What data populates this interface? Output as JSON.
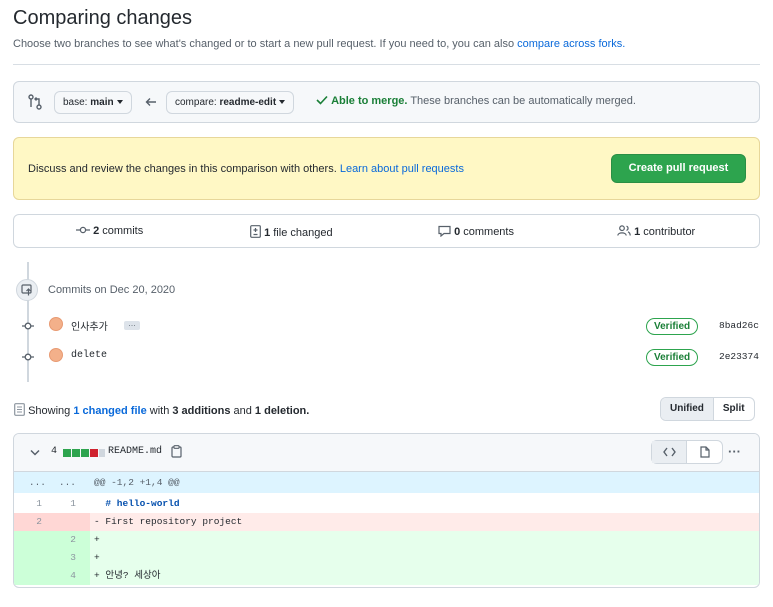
{
  "header": {
    "title": "Comparing changes",
    "subtitle": "Choose two branches to see what's changed or to start a new pull request. If you need to, you can also",
    "subtitle_link": "compare across forks."
  },
  "compare": {
    "base_prefix": "base: ",
    "base_branch": "main",
    "compare_prefix": "compare: ",
    "compare_branch": "readme-edit",
    "merge_status": "Able to merge.",
    "merge_detail": "These branches can be automatically merged."
  },
  "flash": {
    "text": "Discuss and review the changes in this comparison with others.",
    "link": "Learn about pull requests",
    "button": "Create pull request"
  },
  "stats": {
    "commits_count": "2",
    "commits_label": "commits",
    "files_count": "1",
    "files_label": "file changed",
    "comments_count": "0",
    "comments_label": "comments",
    "contributors_count": "1",
    "contributors_label": "contributor"
  },
  "commits": {
    "group_label": "Commits on Dec 20, 2020",
    "items": [
      {
        "message": "인사추가",
        "verified": "Verified",
        "sha": "8bad26c"
      },
      {
        "message": "delete",
        "verified": "Verified",
        "sha": "2e23374"
      }
    ],
    "ellipsis": "…"
  },
  "summary": {
    "prefix": "Showing",
    "changed": "1 changed file",
    "with": "with",
    "additions": "3 additions",
    "and": "and",
    "deletions": "1 deletion."
  },
  "view_toggle": {
    "unified": "Unified",
    "split": "Split"
  },
  "diff": {
    "changes_count": "4",
    "filename": "README.md",
    "more": "···",
    "hunk_left": "...",
    "hunk_right": "...",
    "hunk_header": "@@ -1,2 +1,4 @@",
    "lines": [
      {
        "old": "1",
        "new": "1",
        "text": "  # hello-world"
      },
      {
        "old": "2",
        "new": "",
        "text": "- First repository project"
      },
      {
        "old": "",
        "new": "2",
        "text": "+"
      },
      {
        "old": "",
        "new": "3",
        "text": "+"
      },
      {
        "old": "",
        "new": "4",
        "text": "+ 안녕? 세상아"
      }
    ]
  },
  "colors": {
    "accent": "#0969da",
    "success": "#2da44e",
    "addition": "#e6ffec",
    "deletion": "#ffebe9"
  }
}
